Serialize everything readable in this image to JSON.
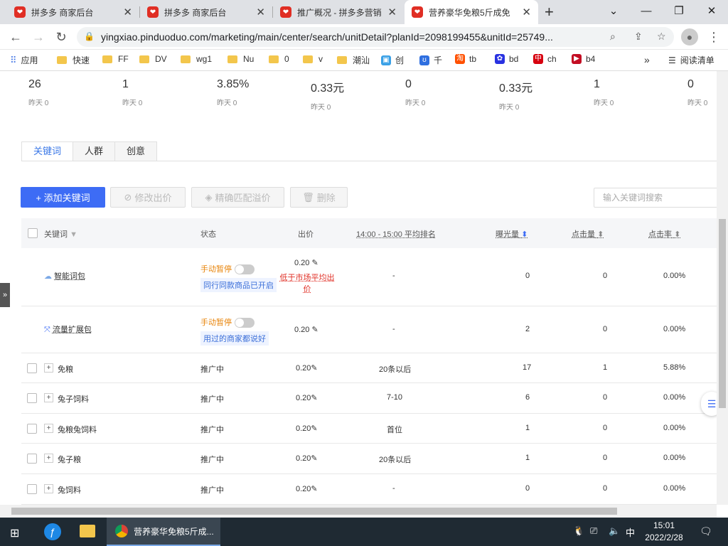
{
  "browser": {
    "tabs": [
      {
        "title": "拼多多 商家后台"
      },
      {
        "title": "拼多多 商家后台"
      },
      {
        "title": "推广概况 - 拼多多营销"
      },
      {
        "title": "营养豪华免粮5斤成免"
      }
    ],
    "url": "yingxiao.pinduoduo.com/marketing/main/center/search/unitDetail?planId=2098199455&unitId=25749...",
    "bookmarks": [
      "应用",
      "快速",
      "FF",
      "DV",
      "wg1",
      "Nu",
      "0",
      "v",
      "潮汕",
      "创",
      "千",
      "tb",
      "bd",
      "ch",
      "b4"
    ],
    "reading_list": "阅读清单",
    "more_bookmarks": "»"
  },
  "stats": [
    {
      "value": "26",
      "sub": "昨天 0"
    },
    {
      "value": "1",
      "sub": "昨天 0"
    },
    {
      "value": "3.85%",
      "sub": "昨天 0"
    },
    {
      "value": "0.33元",
      "sub": "昨天 0"
    },
    {
      "value": "0",
      "sub": "昨天 0"
    },
    {
      "value": "0.33元",
      "sub": "昨天 0"
    },
    {
      "value": "1",
      "sub": "昨天 0"
    },
    {
      "value": "0",
      "sub": "昨天 0"
    }
  ],
  "page_tabs": [
    "关键词",
    "人群",
    "创意"
  ],
  "actions": {
    "add_keyword": "+ 添加关键词",
    "edit_bid": "修改出价",
    "exact_match": "精确匹配溢价",
    "delete": "删除",
    "search_placeholder": "输入关键词搜索"
  },
  "table": {
    "headers": {
      "keyword": "关键词",
      "status": "状态",
      "bid": "出价",
      "rank": "14:00 - 15:00 平均排名",
      "impressions": "曝光量",
      "clicks": "点击量",
      "ctr": "点击率"
    },
    "special_rows": [
      {
        "name": "智能词包",
        "status": "手动暂停",
        "note": "同行同款商品已开启",
        "bid": "0.20",
        "bid_warning": "低于市场平均出价",
        "rank": "-",
        "impressions": "0",
        "clicks": "0",
        "ctr": "0.00%"
      },
      {
        "name": "流量扩展包",
        "status": "手动暂停",
        "note": "用过的商家都说好",
        "bid": "0.20",
        "rank": "-",
        "impressions": "2",
        "clicks": "0",
        "ctr": "0.00%"
      }
    ],
    "rows": [
      {
        "keyword": "免粮",
        "status": "推广中",
        "bid": "0.20",
        "rank": "20条以后",
        "impressions": "17",
        "clicks": "1",
        "ctr": "5.88%"
      },
      {
        "keyword": "兔子饲料",
        "status": "推广中",
        "bid": "0.20",
        "rank": "7-10",
        "impressions": "6",
        "clicks": "0",
        "ctr": "0.00%"
      },
      {
        "keyword": "兔粮兔饲料",
        "status": "推广中",
        "bid": "0.20",
        "rank": "首位",
        "impressions": "1",
        "clicks": "0",
        "ctr": "0.00%"
      },
      {
        "keyword": "兔子粮",
        "status": "推广中",
        "bid": "0.20",
        "rank": "20条以后",
        "impressions": "1",
        "clicks": "0",
        "ctr": "0.00%"
      },
      {
        "keyword": "兔饲料",
        "status": "推广中",
        "bid": "0.20",
        "rank": "-",
        "impressions": "0",
        "clicks": "0",
        "ctr": "0.00%"
      }
    ]
  },
  "taskbar": {
    "active_app": "营养豪华免粮5斤成...",
    "ime": "中",
    "time": "15:01",
    "date": "2022/2/28"
  },
  "colors": {
    "accent": "#3d6cf5",
    "pdd_red": "#e02e24",
    "paused": "#e8850c",
    "warning": "#e02e24"
  }
}
